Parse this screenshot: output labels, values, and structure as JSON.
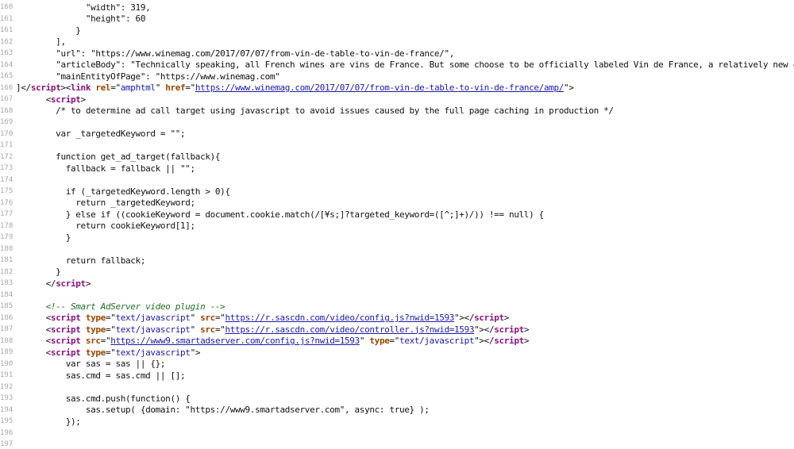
{
  "lines": [
    {
      "n": "160",
      "segs": [
        {
          "c": "txt",
          "t": "              \"width\": 319,"
        }
      ]
    },
    {
      "n": "161",
      "segs": [
        {
          "c": "txt",
          "t": "              \"height\": 60"
        }
      ]
    },
    {
      "n": "161",
      "segs": [
        {
          "c": "txt",
          "t": "            }"
        }
      ]
    },
    {
      "n": "162",
      "segs": [
        {
          "c": "txt",
          "t": "        ],"
        }
      ]
    },
    {
      "n": "163",
      "segs": [
        {
          "c": "txt",
          "t": "        \"url\": \"https://www.winemag.com/2017/07/07/from-vin-de-table-to-vin-de-france/\","
        }
      ]
    },
    {
      "n": "164",
      "segs": [
        {
          "c": "txt",
          "t": "        \"articleBody\": \"Technically speaking, all French wines are vins de France. But some choose to be officially labeled Vin de France, a relatively new category of"
        }
      ]
    },
    {
      "n": "165",
      "segs": [
        {
          "c": "txt",
          "t": "        \"mainEntityOfPage\": \"https://www.winemag.com\""
        }
      ]
    },
    {
      "n": "166",
      "segs": [
        {
          "c": "txt",
          "t": "]</"
        },
        {
          "c": "tag",
          "t": "script"
        },
        {
          "c": "txt",
          "t": "><"
        },
        {
          "c": "tag",
          "t": "link"
        },
        {
          "c": "txt",
          "t": " "
        },
        {
          "c": "attr",
          "t": "rel"
        },
        {
          "c": "txt",
          "t": "=\""
        },
        {
          "c": "val",
          "t": "amphtml"
        },
        {
          "c": "txt",
          "t": "\" "
        },
        {
          "c": "attr",
          "t": "href"
        },
        {
          "c": "txt",
          "t": "=\""
        },
        {
          "c": "link",
          "t": "https://www.winemag.com/2017/07/07/from-vin-de-table-to-vin-de-france/amp/"
        },
        {
          "c": "txt",
          "t": "\">"
        }
      ]
    },
    {
      "n": "167",
      "segs": [
        {
          "c": "txt",
          "t": "      <"
        },
        {
          "c": "tag",
          "t": "script"
        },
        {
          "c": "txt",
          "t": ">"
        }
      ]
    },
    {
      "n": "168",
      "segs": [
        {
          "c": "txt",
          "t": "        /* to determine ad call target using javascript to avoid issues caused by the full page caching in production */"
        }
      ]
    },
    {
      "n": "169",
      "segs": [
        {
          "c": "txt",
          "t": ""
        }
      ]
    },
    {
      "n": "170",
      "segs": [
        {
          "c": "txt",
          "t": "        var _targetedKeyword = \"\";"
        }
      ]
    },
    {
      "n": "171",
      "segs": [
        {
          "c": "txt",
          "t": ""
        }
      ]
    },
    {
      "n": "172",
      "segs": [
        {
          "c": "txt",
          "t": "        function get_ad_target(fallback){"
        }
      ]
    },
    {
      "n": "173",
      "segs": [
        {
          "c": "txt",
          "t": "          fallback = fallback || \"\";"
        }
      ]
    },
    {
      "n": "174",
      "segs": [
        {
          "c": "txt",
          "t": ""
        }
      ]
    },
    {
      "n": "175",
      "segs": [
        {
          "c": "txt",
          "t": "          if (_targetedKeyword.length > 0){"
        }
      ]
    },
    {
      "n": "176",
      "segs": [
        {
          "c": "txt",
          "t": "            return _targetedKeyword;"
        }
      ]
    },
    {
      "n": "177",
      "segs": [
        {
          "c": "txt",
          "t": "          } else if ((cookieKeyword = document.cookie.match(/[¥s;]?targeted_keyword=([^;]+)/)) !== null) {"
        }
      ]
    },
    {
      "n": "178",
      "segs": [
        {
          "c": "txt",
          "t": "            return cookieKeyword[1];"
        }
      ]
    },
    {
      "n": "179",
      "segs": [
        {
          "c": "txt",
          "t": "          }"
        }
      ]
    },
    {
      "n": "180",
      "segs": [
        {
          "c": "txt",
          "t": ""
        }
      ]
    },
    {
      "n": "181",
      "segs": [
        {
          "c": "txt",
          "t": "          return fallback;"
        }
      ]
    },
    {
      "n": "182",
      "segs": [
        {
          "c": "txt",
          "t": "        }"
        }
      ]
    },
    {
      "n": "183",
      "segs": [
        {
          "c": "txt",
          "t": "      </"
        },
        {
          "c": "tag",
          "t": "script"
        },
        {
          "c": "txt",
          "t": ">"
        }
      ]
    },
    {
      "n": "184",
      "segs": [
        {
          "c": "txt",
          "t": ""
        }
      ]
    },
    {
      "n": "185",
      "segs": [
        {
          "c": "cmt",
          "t": "      <!-- Smart AdServer video plugin -->"
        }
      ]
    },
    {
      "n": "186",
      "segs": [
        {
          "c": "txt",
          "t": "      <"
        },
        {
          "c": "tag",
          "t": "script"
        },
        {
          "c": "txt",
          "t": " "
        },
        {
          "c": "attr",
          "t": "type"
        },
        {
          "c": "txt",
          "t": "=\""
        },
        {
          "c": "val",
          "t": "text/javascript"
        },
        {
          "c": "txt",
          "t": "\" "
        },
        {
          "c": "attr",
          "t": "src"
        },
        {
          "c": "txt",
          "t": "=\""
        },
        {
          "c": "link",
          "t": "https://r.sascdn.com/video/config.js?nwid=1593"
        },
        {
          "c": "txt",
          "t": "\"></"
        },
        {
          "c": "tag",
          "t": "script"
        },
        {
          "c": "txt",
          "t": ">"
        }
      ]
    },
    {
      "n": "187",
      "segs": [
        {
          "c": "txt",
          "t": "      <"
        },
        {
          "c": "tag",
          "t": "script"
        },
        {
          "c": "txt",
          "t": " "
        },
        {
          "c": "attr",
          "t": "type"
        },
        {
          "c": "txt",
          "t": "=\""
        },
        {
          "c": "val",
          "t": "text/javascript"
        },
        {
          "c": "txt",
          "t": "\" "
        },
        {
          "c": "attr",
          "t": "src"
        },
        {
          "c": "txt",
          "t": "=\""
        },
        {
          "c": "link",
          "t": "https://r.sascdn.com/video/controller.js?nwid=1593"
        },
        {
          "c": "txt",
          "t": "\"></"
        },
        {
          "c": "tag",
          "t": "script"
        },
        {
          "c": "txt",
          "t": ">"
        }
      ]
    },
    {
      "n": "188",
      "segs": [
        {
          "c": "txt",
          "t": "      <"
        },
        {
          "c": "tag",
          "t": "script"
        },
        {
          "c": "txt",
          "t": " "
        },
        {
          "c": "attr",
          "t": "src"
        },
        {
          "c": "txt",
          "t": "=\""
        },
        {
          "c": "link",
          "t": "https://www9.smartadserver.com/config.js?nwid=1593"
        },
        {
          "c": "txt",
          "t": "\" "
        },
        {
          "c": "attr",
          "t": "type"
        },
        {
          "c": "txt",
          "t": "=\""
        },
        {
          "c": "val",
          "t": "text/javascript"
        },
        {
          "c": "txt",
          "t": "\"></"
        },
        {
          "c": "tag",
          "t": "script"
        },
        {
          "c": "txt",
          "t": ">"
        }
      ]
    },
    {
      "n": "189",
      "segs": [
        {
          "c": "txt",
          "t": "      <"
        },
        {
          "c": "tag",
          "t": "script"
        },
        {
          "c": "txt",
          "t": " "
        },
        {
          "c": "attr",
          "t": "type"
        },
        {
          "c": "txt",
          "t": "=\""
        },
        {
          "c": "val",
          "t": "text/javascript"
        },
        {
          "c": "txt",
          "t": "\">"
        }
      ]
    },
    {
      "n": "190",
      "segs": [
        {
          "c": "txt",
          "t": "          var sas = sas || {};"
        }
      ]
    },
    {
      "n": "191",
      "segs": [
        {
          "c": "txt",
          "t": "          sas.cmd = sas.cmd || [];"
        }
      ]
    },
    {
      "n": "192",
      "segs": [
        {
          "c": "txt",
          "t": ""
        }
      ]
    },
    {
      "n": "193",
      "segs": [
        {
          "c": "txt",
          "t": "          sas.cmd.push(function() {"
        }
      ]
    },
    {
      "n": "194",
      "segs": [
        {
          "c": "txt",
          "t": "              sas.setup( {domain: \"https://www9.smartadserver.com\", async: true} );"
        }
      ]
    },
    {
      "n": "195",
      "segs": [
        {
          "c": "txt",
          "t": "          });"
        }
      ]
    },
    {
      "n": "196",
      "segs": [
        {
          "c": "txt",
          "t": ""
        }
      ]
    },
    {
      "n": "197",
      "segs": [
        {
          "c": "txt",
          "t": ""
        }
      ]
    }
  ]
}
